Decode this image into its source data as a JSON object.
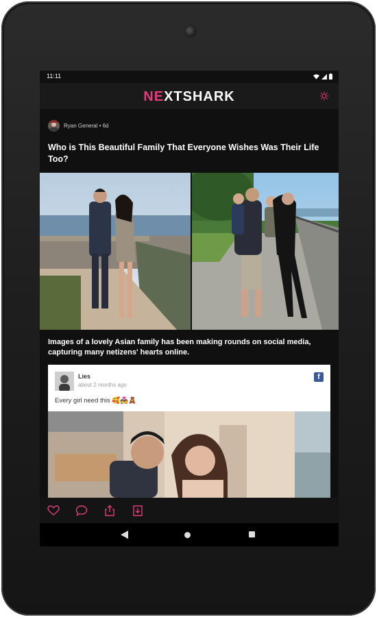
{
  "status_bar": {
    "time": "11:11"
  },
  "app": {
    "logo_part1": "N",
    "logo_part2": "E",
    "logo_part3": "XTSHARK"
  },
  "article": {
    "author": "Ryan General",
    "age": "6d",
    "title": "Who is This Beautiful Family That Everyone Wishes Was Their Life Too?",
    "caption": "Images of a lovely Asian family has been making rounds on social media, capturing many netizens' hearts online."
  },
  "embed": {
    "name": "Lies",
    "time": "about 2 months ago",
    "text": "Every girl need this 🥰💑🧸",
    "network": "f"
  },
  "colors": {
    "accent": "#e03c7a",
    "background": "#101010",
    "facebook": "#3b5998"
  }
}
